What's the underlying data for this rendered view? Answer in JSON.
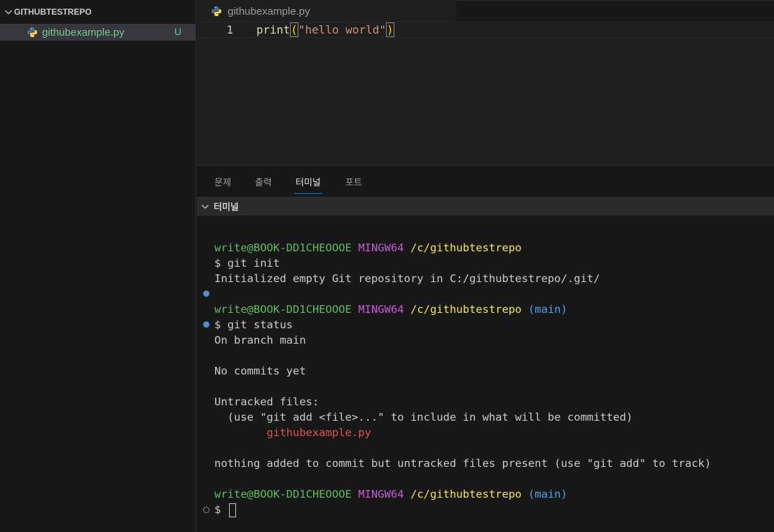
{
  "explorer": {
    "section_title": "GITHUBTESTREPO",
    "file": {
      "name": "githubexample.py",
      "status": "U"
    }
  },
  "editor": {
    "tab_label": "githubexample.py",
    "line_number": "1",
    "code": {
      "fn": "print",
      "open": "(",
      "string": "\"hello world\"",
      "close": ")"
    }
  },
  "panel": {
    "tabs": [
      "문제",
      "출력",
      "터미널",
      "포트"
    ],
    "active_tab": "터미널",
    "terminal_title": "터미널"
  },
  "terminal": {
    "prompt": {
      "user": "write@BOOK-DD1CHEOOOE",
      "env": "MINGW64",
      "path": "/c/githubtestrepo",
      "branch": "(main)"
    },
    "lines": {
      "cmd1": "$ git init",
      "out1": "Initialized empty Git repository in C:/githubtestrepo/.git/",
      "cmd2": "$ git status",
      "out2": "On branch main",
      "out3": "No commits yet",
      "out4": "Untracked files:",
      "out5": "  (use \"git add <file>...\" to include in what will be committed)",
      "out6": "        githubexample.py",
      "out7": "nothing added to commit but untracked files present (use \"git add\" to track)",
      "cmd3": "$"
    }
  },
  "colors": {
    "accent": "#0078d4",
    "untracked": "#73c991",
    "prompt_user": "#5fbb5f",
    "prompt_env": "#c45bd6",
    "prompt_path": "#f5e64a",
    "prompt_branch": "#4aa3e3",
    "error_red": "#e05252"
  },
  "icons": [
    "chevron-down-icon",
    "python-file-icon",
    "terminal-decoration-success-icon",
    "terminal-decoration-pending-icon"
  ]
}
